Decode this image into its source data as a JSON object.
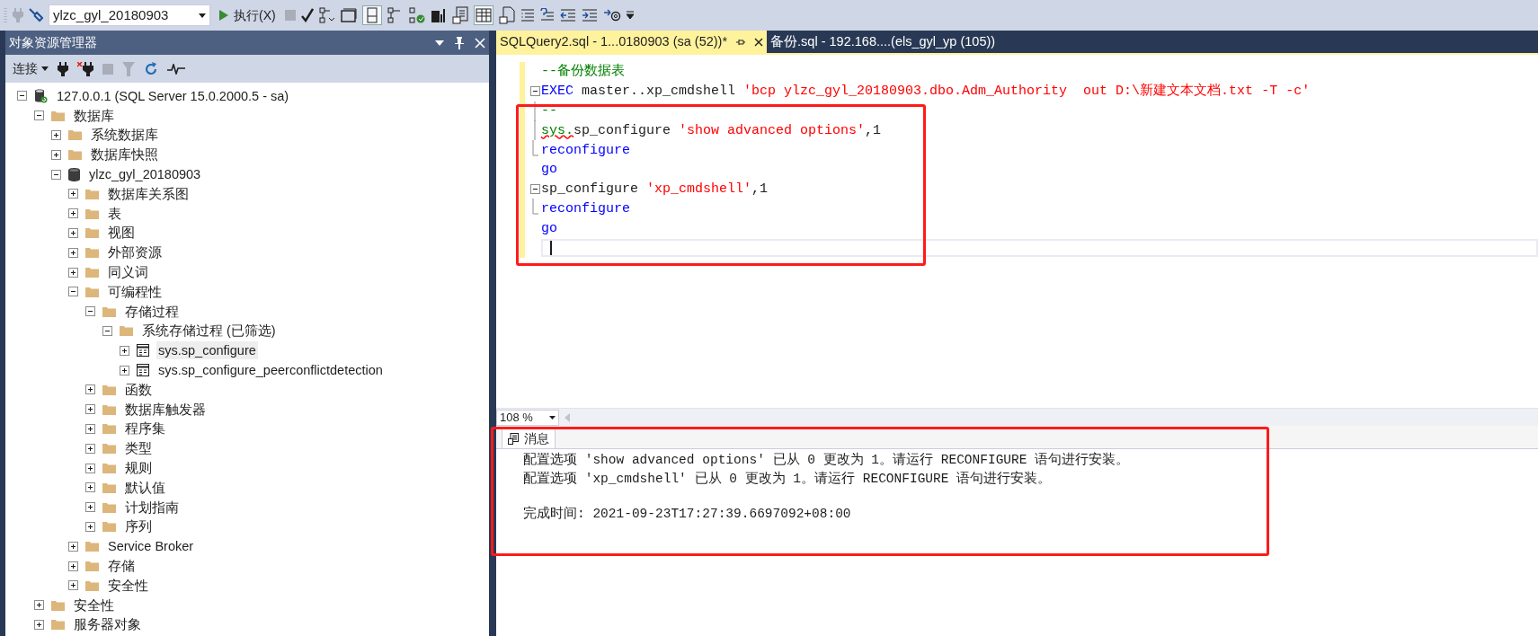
{
  "toolbar": {
    "database": "ylzc_gyl_20180903",
    "execute_label": "执行(X)"
  },
  "object_explorer": {
    "title": "对象资源管理器",
    "connect_label": "连接",
    "tree": [
      {
        "label": "127.0.0.1 (SQL Server 15.0.2000.5 - sa)",
        "kind": "server",
        "expanded": true,
        "selected": false,
        "children": [
          {
            "label": "数据库",
            "kind": "folder",
            "expanded": true,
            "selected": false,
            "children": [
              {
                "label": "系统数据库",
                "kind": "folder",
                "expanded": false,
                "selected": false
              },
              {
                "label": "数据库快照",
                "kind": "folder",
                "expanded": false,
                "selected": false
              },
              {
                "label": "ylzc_gyl_20180903",
                "kind": "database",
                "expanded": true,
                "selected": false,
                "children": [
                  {
                    "label": "数据库关系图",
                    "kind": "folder",
                    "expanded": false,
                    "selected": false
                  },
                  {
                    "label": "表",
                    "kind": "folder",
                    "expanded": false,
                    "selected": false
                  },
                  {
                    "label": "视图",
                    "kind": "folder",
                    "expanded": false,
                    "selected": false
                  },
                  {
                    "label": "外部资源",
                    "kind": "folder",
                    "expanded": false,
                    "selected": false
                  },
                  {
                    "label": "同义词",
                    "kind": "folder",
                    "expanded": false,
                    "selected": false
                  },
                  {
                    "label": "可编程性",
                    "kind": "folder",
                    "expanded": true,
                    "selected": false,
                    "children": [
                      {
                        "label": "存储过程",
                        "kind": "folder",
                        "expanded": true,
                        "selected": false,
                        "children": [
                          {
                            "label": "系统存储过程 (已筛选)",
                            "kind": "folder",
                            "expanded": true,
                            "selected": false,
                            "children": [
                              {
                                "label": "sys.sp_configure",
                                "kind": "procedure",
                                "expanded": false,
                                "selected": true
                              },
                              {
                                "label": "sys.sp_configure_peerconflictdetection",
                                "kind": "procedure",
                                "expanded": false,
                                "selected": false
                              }
                            ]
                          }
                        ]
                      },
                      {
                        "label": "函数",
                        "kind": "folder",
                        "expanded": false,
                        "selected": false
                      },
                      {
                        "label": "数据库触发器",
                        "kind": "folder",
                        "expanded": false,
                        "selected": false
                      },
                      {
                        "label": "程序集",
                        "kind": "folder",
                        "expanded": false,
                        "selected": false
                      },
                      {
                        "label": "类型",
                        "kind": "folder",
                        "expanded": false,
                        "selected": false
                      },
                      {
                        "label": "规则",
                        "kind": "folder",
                        "expanded": false,
                        "selected": false
                      },
                      {
                        "label": "默认值",
                        "kind": "folder",
                        "expanded": false,
                        "selected": false
                      },
                      {
                        "label": "计划指南",
                        "kind": "folder",
                        "expanded": false,
                        "selected": false
                      },
                      {
                        "label": "序列",
                        "kind": "folder",
                        "expanded": false,
                        "selected": false
                      }
                    ]
                  },
                  {
                    "label": "Service Broker",
                    "kind": "folder",
                    "expanded": false,
                    "selected": false
                  },
                  {
                    "label": "存储",
                    "kind": "folder",
                    "expanded": false,
                    "selected": false
                  },
                  {
                    "label": "安全性",
                    "kind": "folder",
                    "expanded": false,
                    "selected": false
                  }
                ]
              }
            ]
          },
          {
            "label": "安全性",
            "kind": "folder",
            "expanded": false,
            "selected": false
          },
          {
            "label": "服务器对象",
            "kind": "folder",
            "expanded": false,
            "selected": false
          }
        ]
      }
    ]
  },
  "editor_tabs": [
    {
      "label": "SQLQuery2.sql - 1...0180903 (sa (52))*",
      "selected": true
    },
    {
      "label": "备份.sql - 192.168....(els_gyl_yp (105))",
      "selected": false
    }
  ],
  "code": {
    "highlighted": true,
    "lines": [
      {
        "kind": "plain",
        "tokens": [
          {
            "text": "--备份数据表",
            "kind": "comment"
          }
        ]
      },
      {
        "kind": "collapse",
        "tokens": [
          {
            "text": "EXEC",
            "kind": "keyword"
          },
          {
            "text": " master..xp_cmdshell ",
            "kind": "plain"
          },
          {
            "text": "'bcp ylzc_gyl_20180903.dbo.Adm_Authority  out D:\\新建文本文档.txt -T -c'",
            "kind": "string"
          }
        ]
      },
      {
        "kind": "branch",
        "tokens": [
          {
            "text": "--",
            "kind": "comment"
          }
        ]
      },
      {
        "kind": "branch",
        "tokens": [
          {
            "text": "sys.",
            "kind": "error"
          },
          {
            "text": "sp_configure ",
            "kind": "plain"
          },
          {
            "text": "'show advanced options'",
            "kind": "string"
          },
          {
            "text": ",1",
            "kind": "plain"
          }
        ]
      },
      {
        "kind": "end",
        "tokens": [
          {
            "text": "reconfigure",
            "kind": "keyword"
          }
        ]
      },
      {
        "kind": "plain",
        "tokens": [
          {
            "text": "go",
            "kind": "keyword"
          }
        ]
      },
      {
        "kind": "collapse",
        "tokens": [
          {
            "text": "sp_configure ",
            "kind": "plain"
          },
          {
            "text": "'xp_cmdshell'",
            "kind": "string"
          },
          {
            "text": ",1",
            "kind": "plain"
          }
        ]
      },
      {
        "kind": "end",
        "tokens": [
          {
            "text": "reconfigure",
            "kind": "keyword"
          }
        ]
      },
      {
        "kind": "plain",
        "tokens": [
          {
            "text": "go",
            "kind": "keyword"
          }
        ]
      },
      {
        "kind": "cursor"
      }
    ]
  },
  "zoom": "108 %",
  "results": {
    "highlighted": true,
    "tabs": [
      {
        "label": "消息",
        "selected": true
      }
    ],
    "messages": [
      "配置选项 'show advanced options' 已从 0 更改为 1。请运行 RECONFIGURE 语句进行安装。",
      "配置选项 'xp_cmdshell' 已从 0 更改为 1。请运行 RECONFIGURE 语句进行安装。"
    ],
    "completion": "完成时间: 2021-09-23T17:27:39.6697092+08:00"
  }
}
